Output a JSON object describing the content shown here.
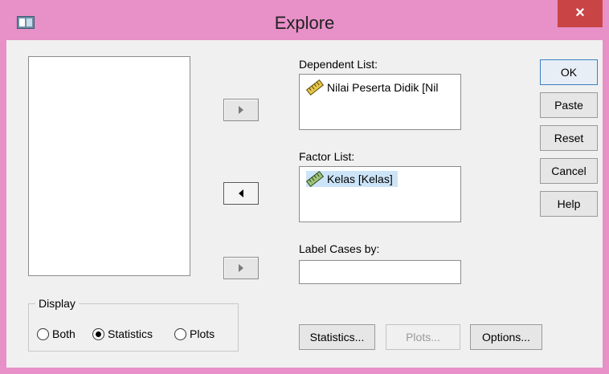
{
  "window": {
    "title": "Explore",
    "close_label": "×"
  },
  "source_list": {
    "items": []
  },
  "dependent_list": {
    "label": "Dependent List:",
    "items": [
      {
        "text": "Nilai Peserta Didik [Nil",
        "icon": "scale-ruler-icon"
      }
    ]
  },
  "factor_list": {
    "label": "Factor List:",
    "items": [
      {
        "text": "Kelas  [Kelas]",
        "icon": "scale-ruler-icon",
        "selected": true
      }
    ]
  },
  "label_cases": {
    "label": "Label Cases by:",
    "value": ""
  },
  "side_buttons": {
    "ok": "OK",
    "paste": "Paste",
    "reset": "Reset",
    "cancel": "Cancel",
    "help": "Help"
  },
  "bottom_buttons": {
    "statistics": "Statistics...",
    "plots": "Plots...",
    "options": "Options..."
  },
  "display": {
    "title": "Display",
    "options": [
      {
        "label": "Both",
        "checked": false
      },
      {
        "label": "Statistics",
        "checked": true
      },
      {
        "label": "Plots",
        "checked": false
      }
    ]
  },
  "colors": {
    "titlebar": "#e890c8",
    "close": "#c94545",
    "dialog": "#f0f0f0",
    "selection": "#cce4f7"
  }
}
